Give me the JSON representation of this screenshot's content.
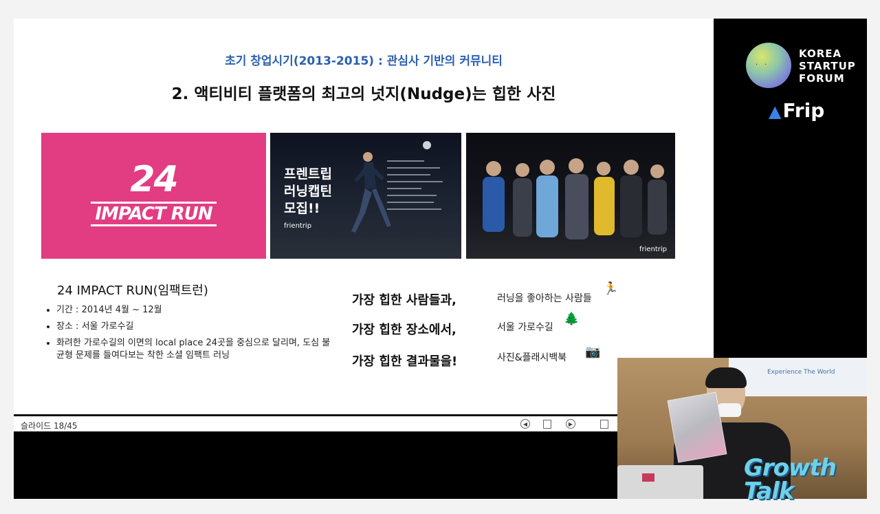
{
  "slide": {
    "subtitle": "초기 창업시기(2013-2015) : 관심사 기반의 커뮤니티",
    "title": "2. 액티비티 플랫폼의 최고의 넛지(Nudge)는 힙한 사진",
    "images": {
      "logo": {
        "number": "24",
        "text": "IMPACT RUN"
      },
      "poster": {
        "headline_lines": [
          "프렌트립",
          "러닝캡틴",
          "모집!!"
        ],
        "brand": "frientrip"
      },
      "group_photo": {
        "brand": "frientrip"
      }
    },
    "section_heading": "24 IMPACT RUN(임팩트런)",
    "bullets": [
      "기간 : 2014년 4월 ~ 12월",
      "장소 : 서울 가로수길",
      "화려한 가로수길의 이면의 local place 24곳을 중심으로 달리며, 도심 불균형 문제를 들여다보는 착한 소셜 임팩트 러닝"
    ],
    "hip_lines": [
      "가장 힙한 사람들과,",
      "가장 힙한 장소에서,",
      "가장 힙한 결과물을!"
    ],
    "notes": [
      "러닝을 좋아하는 사람들",
      "서울 가로수길",
      "사진&플래시백북"
    ],
    "note_icons": [
      "runner-emoji",
      "tree-emoji",
      "camera-emoji"
    ]
  },
  "viewer": {
    "counter": "슬라이드 18/45",
    "buttons": [
      "prev-slide-button",
      "slide-sorter-button",
      "next-slide-button",
      "fullscreen-button"
    ]
  },
  "branding": {
    "org_lines": [
      "KOREA",
      "STARTUP",
      "FORUM"
    ],
    "frip": "Frip"
  },
  "webcam": {
    "banner": "Experience The World",
    "sign": "Growth Talk"
  }
}
